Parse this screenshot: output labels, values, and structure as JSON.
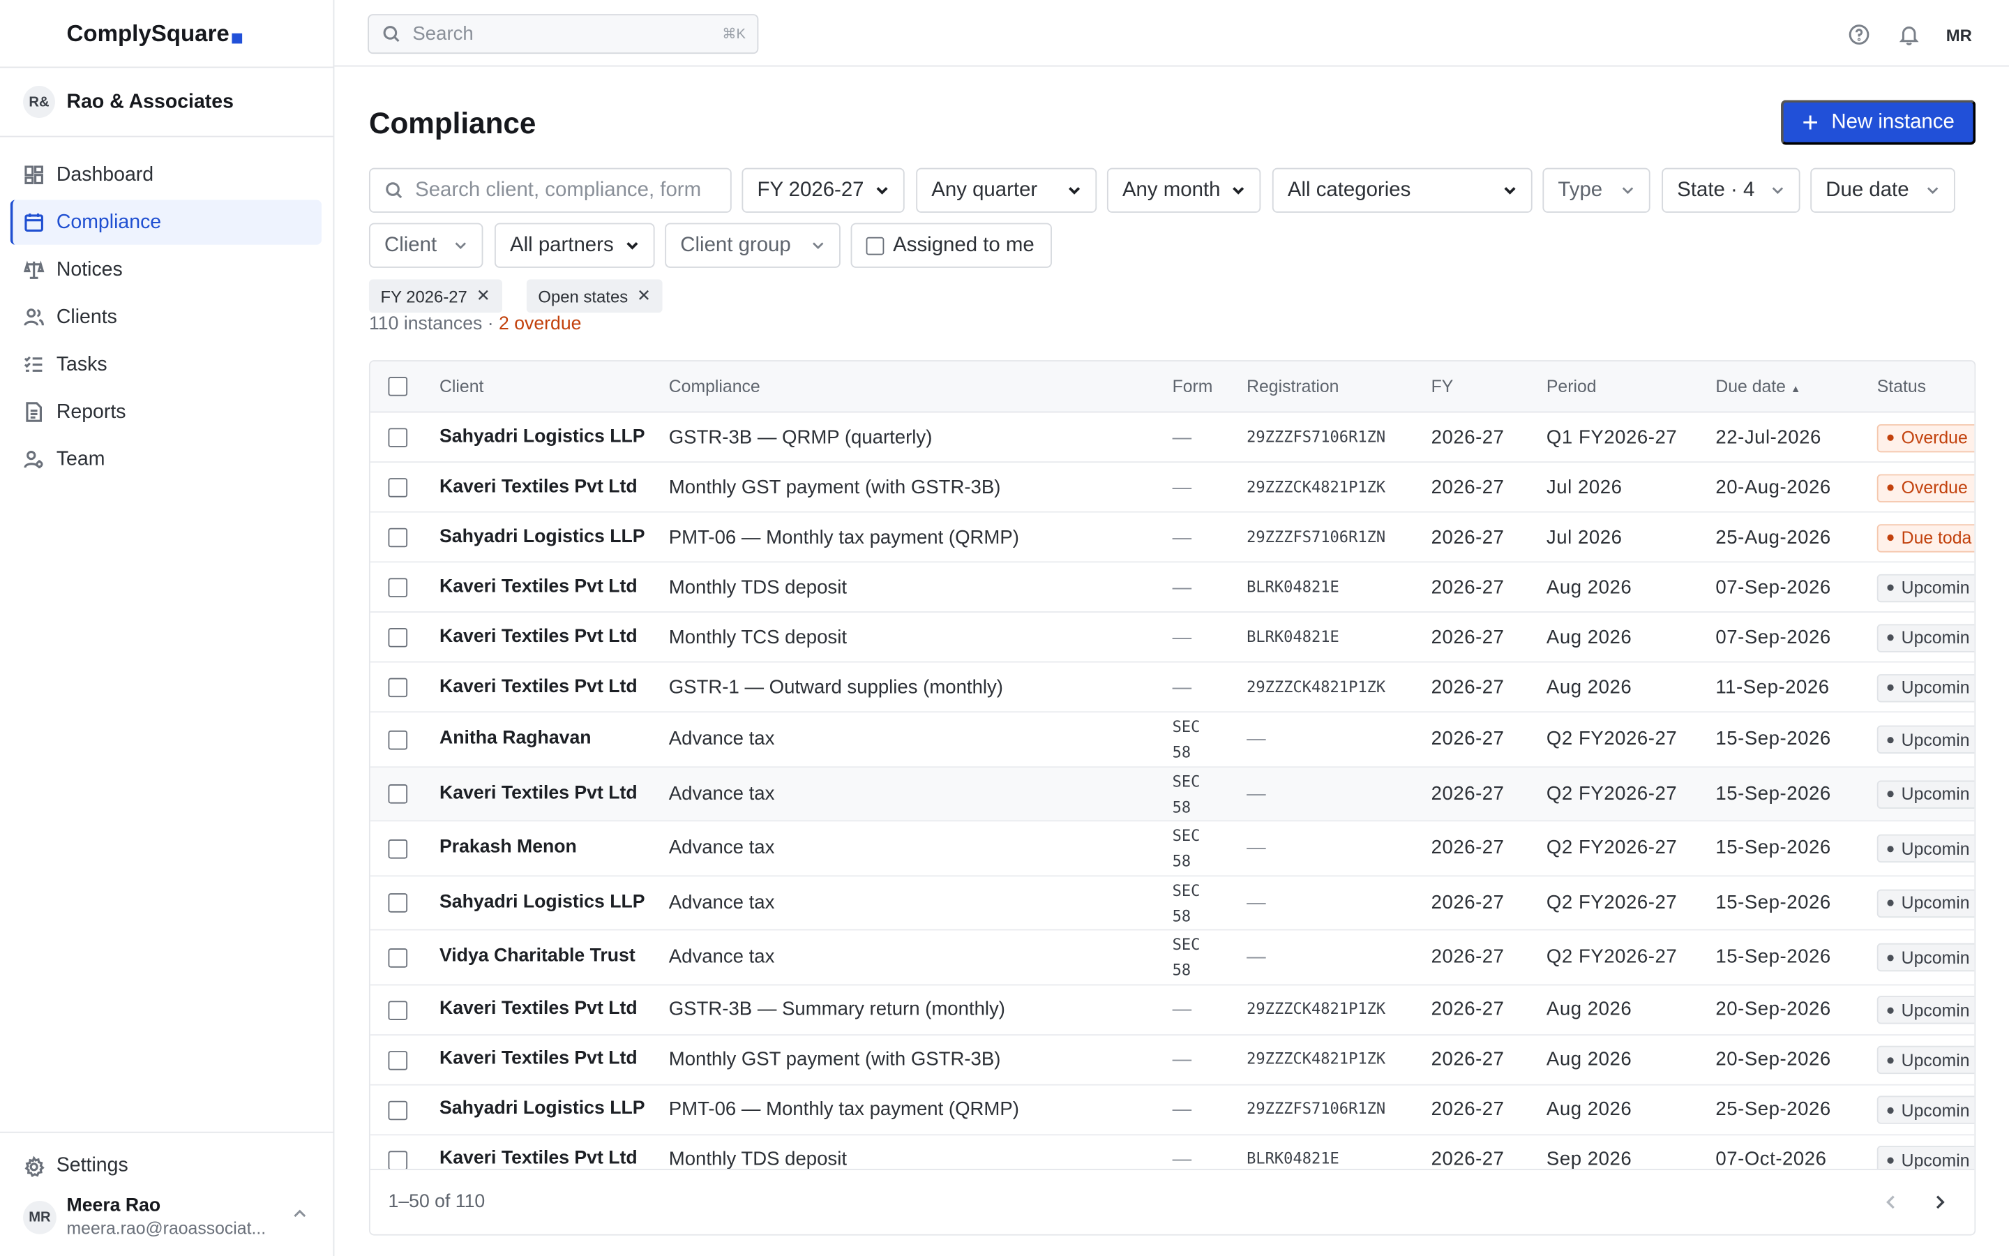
{
  "app": {
    "name": "ComplySquare",
    "brand_color": "#2150d8"
  },
  "org": {
    "badge": "R&",
    "name": "Rao & Associates"
  },
  "sidebar": {
    "items": [
      {
        "label": "Dashboard",
        "icon": "dashboard-icon"
      },
      {
        "label": "Compliance",
        "icon": "calendar-icon",
        "active": true
      },
      {
        "label": "Notices",
        "icon": "scale-icon"
      },
      {
        "label": "Clients",
        "icon": "users-icon"
      },
      {
        "label": "Tasks",
        "icon": "checklist-icon"
      },
      {
        "label": "Reports",
        "icon": "document-icon"
      },
      {
        "label": "Team",
        "icon": "team-icon"
      }
    ],
    "settings_label": "Settings"
  },
  "user": {
    "initials": "MR",
    "name": "Meera Rao",
    "email": "meera.rao@raoassociat..."
  },
  "topbar": {
    "search_placeholder": "Search",
    "shortcut": "⌘K",
    "avatar": "MR"
  },
  "page": {
    "title": "Compliance",
    "new_button": "New instance",
    "filters": {
      "search_placeholder": "Search client, compliance, form",
      "fy": "FY 2026-27",
      "quarter": "Any quarter",
      "month": "Any month",
      "category": "All categories",
      "type": "Type",
      "state": "State · 4",
      "due_date": "Due date",
      "client": "Client",
      "partners": "All partners",
      "client_group": "Client group",
      "assigned": "Assigned to me"
    },
    "chips": [
      "FY 2026-27",
      "Open states"
    ],
    "summary": {
      "count": "110 instances",
      "sep": " · ",
      "overdue": "2 overdue"
    }
  },
  "table": {
    "columns": [
      "Client",
      "Compliance",
      "Form",
      "Registration",
      "FY",
      "Period",
      "Due date",
      "Status"
    ],
    "sort_indicator": "▲",
    "rows": [
      {
        "client": "Sahyadri Logistics LLP",
        "compliance": "GSTR-3B — QRMP (quarterly)",
        "form": "—",
        "registration": "29ZZZFS7106R1ZN",
        "fy": "2026-27",
        "period": "Q1 FY2026-27",
        "due": "22-Jul-2026",
        "status": "Overdue",
        "kind": "overdue"
      },
      {
        "client": "Kaveri Textiles Pvt Ltd",
        "compliance": "Monthly GST payment (with GSTR-3B)",
        "form": "—",
        "registration": "29ZZZCK4821P1ZK",
        "fy": "2026-27",
        "period": "Jul 2026",
        "due": "20-Aug-2026",
        "status": "Overdue",
        "kind": "overdue"
      },
      {
        "client": "Sahyadri Logistics LLP",
        "compliance": "PMT-06 — Monthly tax payment (QRMP)",
        "form": "—",
        "registration": "29ZZZFS7106R1ZN",
        "fy": "2026-27",
        "period": "Jul 2026",
        "due": "25-Aug-2026",
        "status": "Due toda",
        "kind": "overdue"
      },
      {
        "client": "Kaveri Textiles Pvt Ltd",
        "compliance": "Monthly TDS deposit",
        "form": "—",
        "registration": "BLRK04821E",
        "fy": "2026-27",
        "period": "Aug 2026",
        "due": "07-Sep-2026",
        "status": "Upcomin",
        "kind": "upcoming"
      },
      {
        "client": "Kaveri Textiles Pvt Ltd",
        "compliance": "Monthly TCS deposit",
        "form": "—",
        "registration": "BLRK04821E",
        "fy": "2026-27",
        "period": "Aug 2026",
        "due": "07-Sep-2026",
        "status": "Upcomin",
        "kind": "upcoming"
      },
      {
        "client": "Kaveri Textiles Pvt Ltd",
        "compliance": "GSTR-1 — Outward supplies (monthly)",
        "form": "—",
        "registration": "29ZZZCK4821P1ZK",
        "fy": "2026-27",
        "period": "Aug 2026",
        "due": "11-Sep-2026",
        "status": "Upcomin",
        "kind": "upcoming"
      },
      {
        "client": "Anitha Raghavan",
        "compliance": "Advance tax",
        "form": "SEC 58",
        "registration": "—",
        "fy": "2026-27",
        "period": "Q2 FY2026-27",
        "due": "15-Sep-2026",
        "status": "Upcomin",
        "kind": "upcoming"
      },
      {
        "client": "Kaveri Textiles Pvt Ltd",
        "compliance": "Advance tax",
        "form": "SEC 58",
        "registration": "—",
        "fy": "2026-27",
        "period": "Q2 FY2026-27",
        "due": "15-Sep-2026",
        "status": "Upcomin",
        "kind": "upcoming",
        "highlight": true
      },
      {
        "client": "Prakash Menon",
        "compliance": "Advance tax",
        "form": "SEC 58",
        "registration": "—",
        "fy": "2026-27",
        "period": "Q2 FY2026-27",
        "due": "15-Sep-2026",
        "status": "Upcomin",
        "kind": "upcoming"
      },
      {
        "client": "Sahyadri Logistics LLP",
        "compliance": "Advance tax",
        "form": "SEC 58",
        "registration": "—",
        "fy": "2026-27",
        "period": "Q2 FY2026-27",
        "due": "15-Sep-2026",
        "status": "Upcomin",
        "kind": "upcoming"
      },
      {
        "client": "Vidya Charitable Trust",
        "compliance": "Advance tax",
        "form": "SEC 58",
        "registration": "—",
        "fy": "2026-27",
        "period": "Q2 FY2026-27",
        "due": "15-Sep-2026",
        "status": "Upcomin",
        "kind": "upcoming"
      },
      {
        "client": "Kaveri Textiles Pvt Ltd",
        "compliance": "GSTR-3B — Summary return (monthly)",
        "form": "—",
        "registration": "29ZZZCK4821P1ZK",
        "fy": "2026-27",
        "period": "Aug 2026",
        "due": "20-Sep-2026",
        "status": "Upcomin",
        "kind": "upcoming"
      },
      {
        "client": "Kaveri Textiles Pvt Ltd",
        "compliance": "Monthly GST payment (with GSTR-3B)",
        "form": "—",
        "registration": "29ZZZCK4821P1ZK",
        "fy": "2026-27",
        "period": "Aug 2026",
        "due": "20-Sep-2026",
        "status": "Upcomin",
        "kind": "upcoming"
      },
      {
        "client": "Sahyadri Logistics LLP",
        "compliance": "PMT-06 — Monthly tax payment (QRMP)",
        "form": "—",
        "registration": "29ZZZFS7106R1ZN",
        "fy": "2026-27",
        "period": "Aug 2026",
        "due": "25-Sep-2026",
        "status": "Upcomin",
        "kind": "upcoming"
      },
      {
        "client": "Kaveri Textiles Pvt Ltd",
        "compliance": "Monthly TDS deposit",
        "form": "—",
        "registration": "BLRK04821E",
        "fy": "2026-27",
        "period": "Sep 2026",
        "due": "07-Oct-2026",
        "status": "Upcomin",
        "kind": "upcoming"
      }
    ],
    "pagination": "1–50 of 110"
  }
}
